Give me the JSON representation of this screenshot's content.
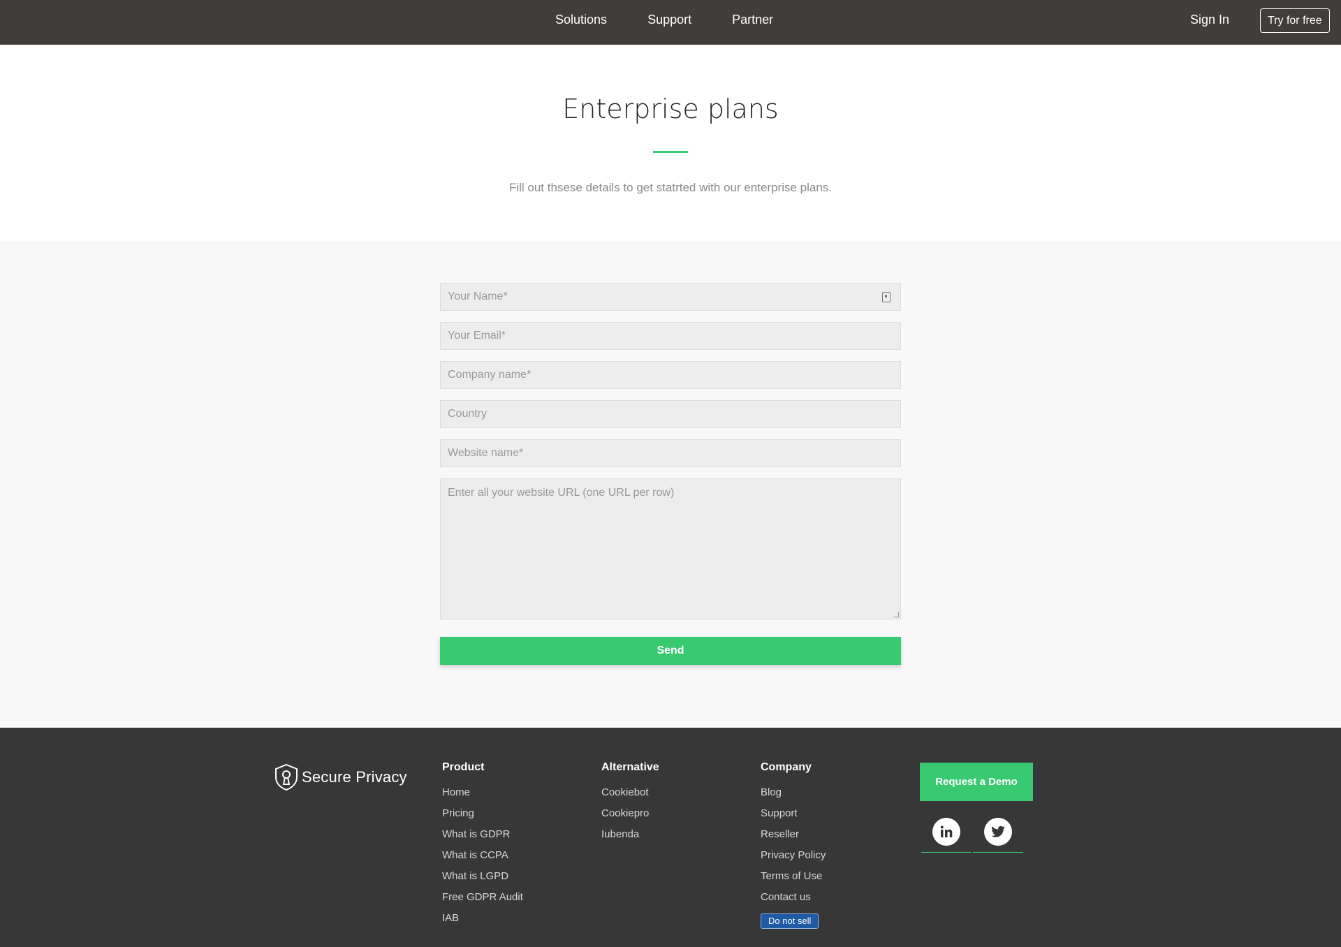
{
  "nav": {
    "links": [
      "Solutions",
      "Support",
      "Partner"
    ],
    "sign_in": "Sign In",
    "try_free": "Try for free"
  },
  "hero": {
    "title": "Enterprise plans",
    "subtitle": "Fill out thsese details to get statrted with our enterprise plans."
  },
  "form": {
    "name_placeholder": "Your Name*",
    "email_placeholder": "Your Email*",
    "company_placeholder": "Company name*",
    "country_placeholder": "Country",
    "website_placeholder": "Website name*",
    "urls_placeholder": "Enter all your website URL (one URL per row)",
    "send_label": "Send"
  },
  "footer": {
    "brand": "Secure Privacy",
    "product": {
      "heading": "Product",
      "links": [
        "Home",
        "Pricing",
        "What is GDPR",
        "What is CCPA",
        "What is LGPD",
        "Free GDPR Audit",
        "IAB"
      ]
    },
    "alternative": {
      "heading": "Alternative",
      "links": [
        "Cookiebot",
        "Cookiepro",
        "Iubenda"
      ]
    },
    "company": {
      "heading": "Company",
      "links": [
        "Blog",
        "Support",
        "Reseller",
        "Privacy Policy",
        "Terms of Use",
        "Contact us"
      ],
      "do_not_sell": "Do not sell"
    },
    "request_demo": "Request a Demo",
    "social_icons": [
      "linkedin-icon",
      "twitter-icon"
    ]
  },
  "colors": {
    "nav_bg": "#413d3a",
    "accent": "#38c971",
    "footer_bg": "#373737",
    "badge_blue": "#1f5aa6"
  }
}
